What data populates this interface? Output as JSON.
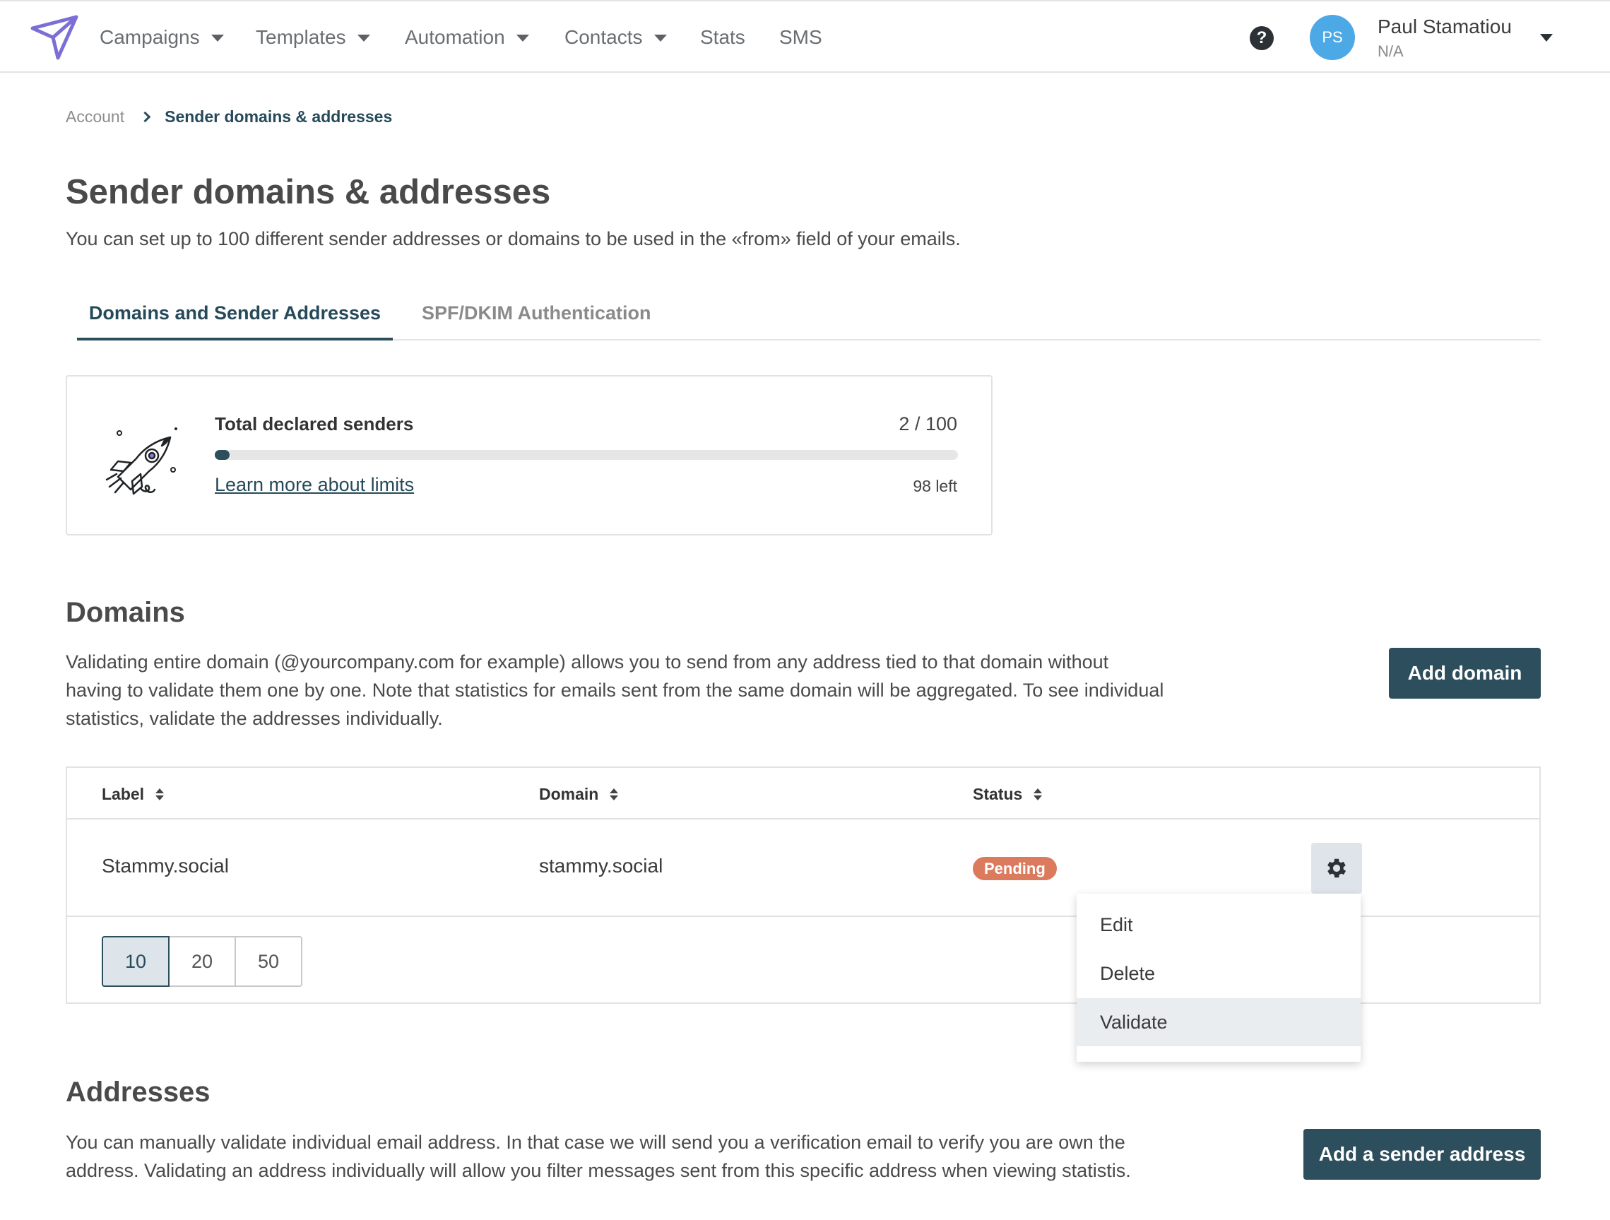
{
  "nav": {
    "items": [
      {
        "label": "Campaigns",
        "dropdown": true
      },
      {
        "label": "Templates",
        "dropdown": true
      },
      {
        "label": "Automation",
        "dropdown": true
      },
      {
        "label": "Contacts",
        "dropdown": true
      },
      {
        "label": "Stats",
        "dropdown": false
      },
      {
        "label": "SMS",
        "dropdown": false
      }
    ],
    "help_label": "?",
    "user": {
      "initials": "PS",
      "name": "Paul Stamatiou",
      "subtitle": "N/A"
    }
  },
  "breadcrumb": {
    "parent": "Account",
    "current": "Sender domains & addresses"
  },
  "page": {
    "title": "Sender domains & addresses",
    "description": "You can set up to 100 different sender addresses or domains to be used in the «from» field of your emails."
  },
  "tabs": [
    {
      "label": "Domains and Sender Addresses",
      "active": true
    },
    {
      "label": "SPF/DKIM Authentication",
      "active": false
    }
  ],
  "senders_card": {
    "label": "Total declared senders",
    "count": "2 / 100",
    "progress_fraction": 0.02,
    "link": "Learn more about limits",
    "remaining": "98 left"
  },
  "domains": {
    "title": "Domains",
    "description": "Validating entire domain (@yourcompany.com for example) allows you to send from any address tied to that domain without having to validate them one by one. Note that statistics for emails sent from the same domain will be aggregated. To see individual statistics, validate the addresses individually.",
    "add_button": "Add domain",
    "columns": [
      "Label",
      "Domain",
      "Status"
    ],
    "rows": [
      {
        "label": "Stammy.social",
        "domain": "stammy.social",
        "status": "Pending"
      }
    ],
    "page_sizes": [
      "10",
      "20",
      "50"
    ],
    "selected_page_size": "10",
    "menu": [
      "Edit",
      "Delete",
      "Validate"
    ],
    "menu_hovered": "Validate"
  },
  "addresses": {
    "title": "Addresses",
    "description": "You can manually validate individual email address. In that case we will send you a verification email to verify you are own the address. Validating an address individually will allow you filter messages sent from this specific address when viewing statistis.",
    "add_button": "Add a sender address"
  },
  "colors": {
    "brand": "#2d4e5c",
    "pending": "#db7a5c",
    "avatar": "#4da8e6",
    "logo": "#7b6fd6"
  }
}
